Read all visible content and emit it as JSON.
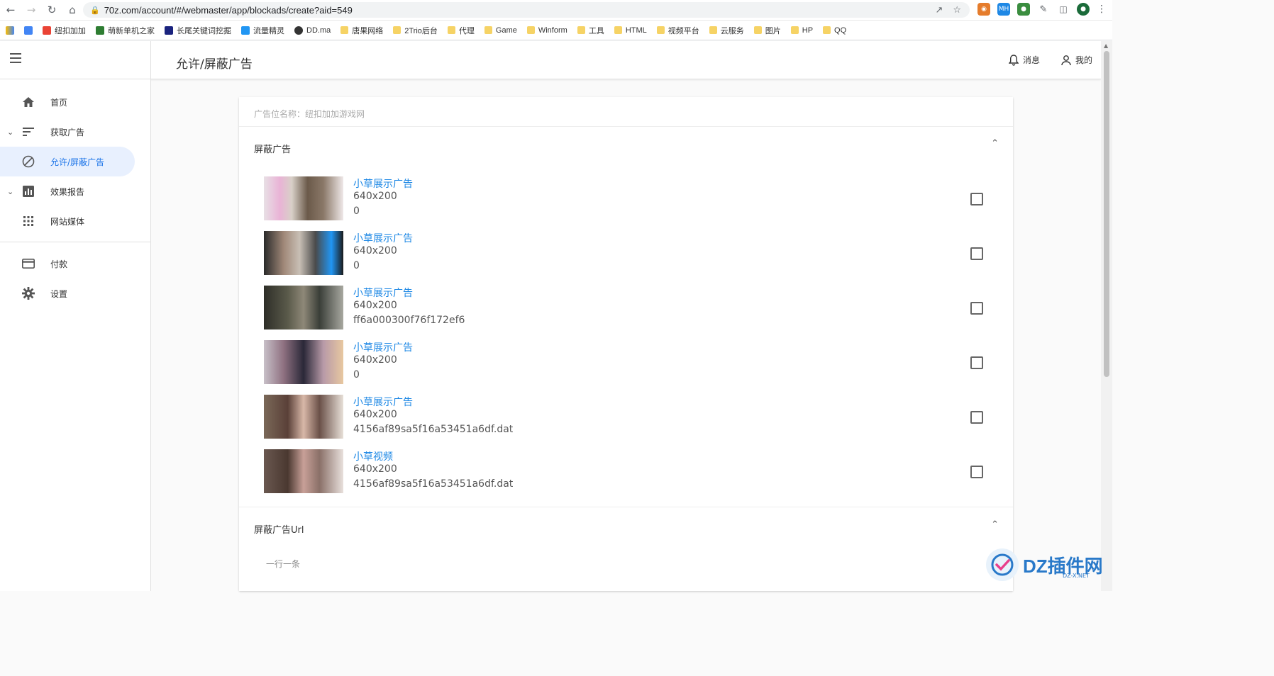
{
  "browser": {
    "url": "70z.com/account/#/webmaster/app/blockads/create?aid=549",
    "bookmarks": [
      "纽扣加加",
      "萌新单机之家",
      "长尾关键词挖掘",
      "流量精灵",
      "DD.ma",
      "唐果网络",
      "2Trio后台",
      "代理",
      "Game",
      "Winform",
      "工具",
      "HTML",
      "视频平台",
      "云服务",
      "图片",
      "HP",
      "QQ"
    ],
    "ext_mh": "MH"
  },
  "header": {
    "title": "允许/屏蔽广告",
    "messages_label": "消息",
    "profile_label": "我的"
  },
  "sidebar": {
    "items": [
      {
        "label": "首页"
      },
      {
        "label": "获取广告"
      },
      {
        "label": "允许/屏蔽广告"
      },
      {
        "label": "效果报告"
      },
      {
        "label": "网站媒体"
      },
      {
        "label": "付款"
      },
      {
        "label": "设置"
      }
    ]
  },
  "content": {
    "slot_label": "广告位名称：纽扣加加游戏网",
    "block_section_title": "屏蔽广告",
    "ads": [
      {
        "name": "小草展示广告",
        "size": "640x200",
        "id": "0",
        "checked": false
      },
      {
        "name": "小草展示广告",
        "size": "640x200",
        "id": "0",
        "checked": false
      },
      {
        "name": "小草展示广告",
        "size": "640x200",
        "id": "ff6a000300f76f172ef6",
        "checked": false
      },
      {
        "name": "小草展示广告",
        "size": "640x200",
        "id": "0",
        "checked": false
      },
      {
        "name": "小草展示广告",
        "size": "640x200",
        "id": "4156af89sa5f16a53451a6df.dat",
        "checked": false
      },
      {
        "name": "小草视频",
        "size": "640x200",
        "id": "4156af89sa5f16a53451a6df.dat",
        "checked": false
      }
    ],
    "url_section_title": "屏蔽广告Url",
    "url_placeholder": "一行一条"
  },
  "watermark": {
    "text": "DZ插件网",
    "sub": "DZ-X.NET"
  },
  "colors": {
    "accent": "#1a73e8",
    "link": "#1e88e5",
    "active_bg": "#e8f0fe"
  }
}
